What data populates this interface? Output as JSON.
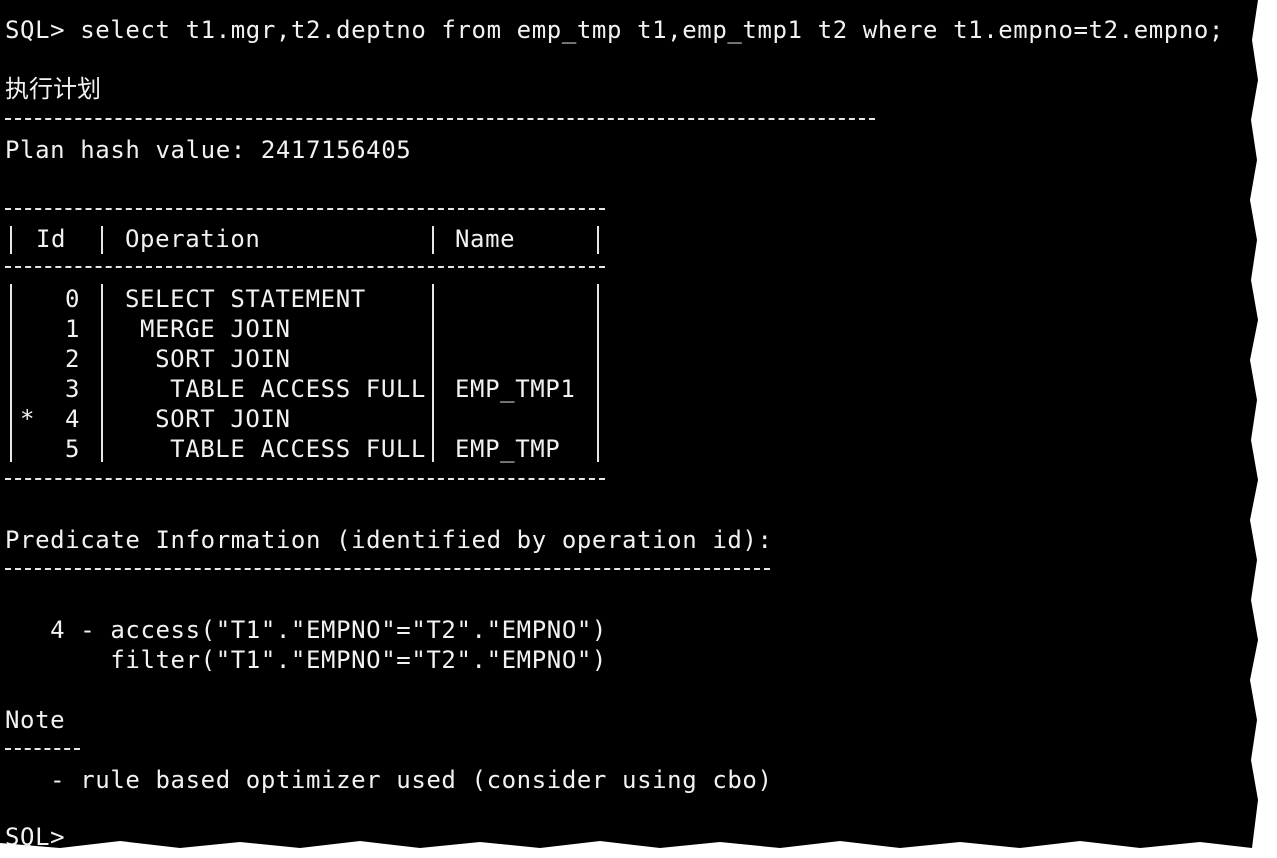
{
  "terminal": {
    "query": "SQL> select t1.mgr,t2.deptno from emp_tmp t1,emp_tmp1 t2 where t1.empno=t2.empno;",
    "plan_heading": "执行计划",
    "plan_hash": "Plan hash value: 2417156405",
    "plan_table": {
      "headers": {
        "id": "Id",
        "operation": "Operation",
        "name": "Name"
      },
      "rows": [
        {
          "marker": "",
          "id": "0",
          "operation": "SELECT STATEMENT",
          "name": ""
        },
        {
          "marker": "",
          "id": "1",
          "operation": " MERGE JOIN",
          "name": ""
        },
        {
          "marker": "",
          "id": "2",
          "operation": "  SORT JOIN",
          "name": ""
        },
        {
          "marker": "",
          "id": "3",
          "operation": "   TABLE ACCESS FULL",
          "name": "EMP_TMP1"
        },
        {
          "marker": "*",
          "id": "4",
          "operation": "  SORT JOIN",
          "name": ""
        },
        {
          "marker": "",
          "id": "5",
          "operation": "   TABLE ACCESS FULL",
          "name": "EMP_TMP"
        }
      ]
    },
    "predicate_heading": "Predicate Information (identified by operation id):",
    "predicate_access": "   4 - access(\"T1\".\"EMPNO\"=\"T2\".\"EMPNO\")",
    "predicate_filter": "       filter(\"T1\".\"EMPNO\"=\"T2\".\"EMPNO\")",
    "note_heading": "Note",
    "note_text": "   - rule based optimizer used (consider using cbo)",
    "prompt": "SQL>"
  }
}
